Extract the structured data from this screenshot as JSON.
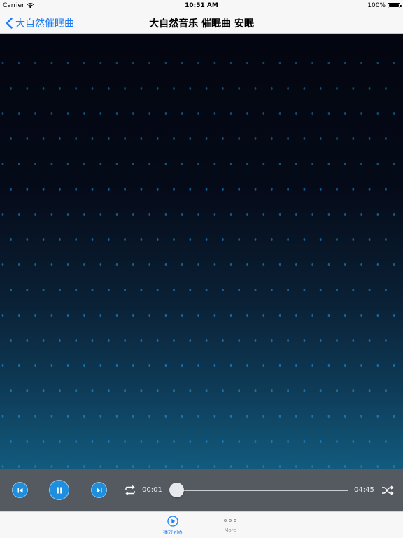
{
  "status_bar": {
    "carrier": "Carrier",
    "time": "10:51 AM",
    "battery": "100%",
    "battery_level": 1.0,
    "wifi_icon": "wifi-icon"
  },
  "nav": {
    "back_label": "大自然催眠曲",
    "back_icon": "chevron-left-icon",
    "title": "大自然音乐 催眠曲 安眠"
  },
  "visualizer": {
    "dot_color": "#1f78b4"
  },
  "player": {
    "current_time": "00:01",
    "total_time": "04:45",
    "progress": 0.004,
    "state": "playing",
    "accent": "#1e8ede",
    "icons": [
      "skip-previous-icon",
      "pause-icon",
      "skip-next-icon",
      "repeat-icon",
      "shuffle-icon"
    ]
  },
  "tabs": [
    {
      "label": "播放列表",
      "icon": "play-circle-icon",
      "selected": true
    },
    {
      "label": "More",
      "icon": "more-dots-icon",
      "selected": false
    }
  ],
  "colors": {
    "ios_blue": "#1a7cf6",
    "player_bg": "#545a60"
  }
}
